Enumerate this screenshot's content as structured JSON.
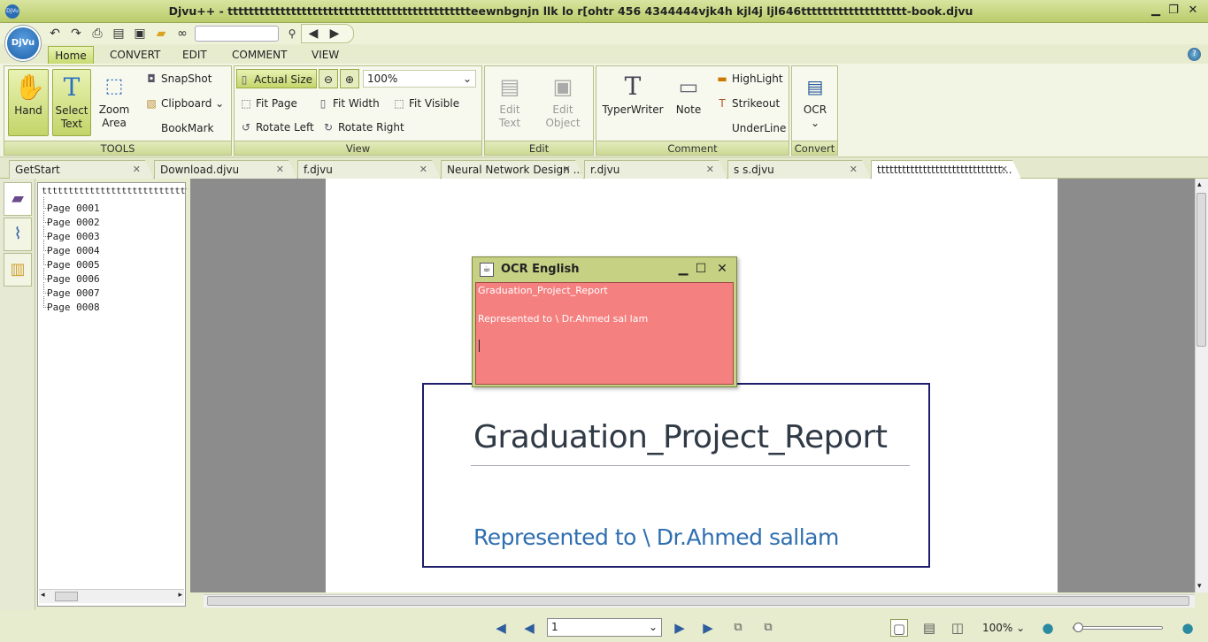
{
  "window": {
    "title": "Djvu++ - tttttttttttttttttttttttttttttttttttttttttttttteewnbgnjn llk lo   r[ohtr 456 4344444vjk4h kjl4j ljl646tttttttttttttttttttt-book.djvu",
    "minimize": "▁",
    "restore": "❐",
    "close": "✕"
  },
  "logo_text": "DjVu",
  "menu": {
    "tabs": [
      {
        "label": "Home",
        "active": true
      },
      {
        "label": "CONVERT"
      },
      {
        "label": "EDIT"
      },
      {
        "label": "COMMENT"
      },
      {
        "label": "VIEW"
      }
    ],
    "help": "?"
  },
  "ribbon": {
    "tools": {
      "label": "TOOLS",
      "hand": "Hand",
      "select_text": "Select Text",
      "zoom_area": "Zoom Area",
      "snapshot": "SnapShot",
      "clipboard": "Clipboard",
      "bookmark": "BookMark"
    },
    "view": {
      "label": "View",
      "actual_size": "Actual Size",
      "zoom_value": "100%",
      "fit_page": "Fit Page",
      "fit_width": "Fit Width",
      "fit_visible": "Fit Visible",
      "rotate_left": "Rotate Left",
      "rotate_right": "Rotate Right"
    },
    "edit": {
      "label": "Edit",
      "edit_text": "Edit Text",
      "edit_object": "Edit Object"
    },
    "comment": {
      "label": "Comment",
      "typewriter": "TyperWriter",
      "note": "Note",
      "highlight": "HighLight",
      "strikeout": "Strikeout",
      "underline": "UnderLine"
    },
    "convert": {
      "label": "Convert",
      "ocr": "OCR"
    }
  },
  "doc_tabs": [
    {
      "label": "GetStart"
    },
    {
      "label": "Download.djvu"
    },
    {
      "label": "f.djvu"
    },
    {
      "label": "Neural Network Design ..."
    },
    {
      "label": "r.djvu"
    },
    {
      "label": "s s.djvu"
    },
    {
      "label": "tttttttttttttttttttttttttttttt...",
      "active": true
    }
  ],
  "tree": {
    "root": "tttttttttttttttttttttttttttttttttttttttttttttteewnbgnjn",
    "pages": [
      "Page 0001",
      "Page 0002",
      "Page 0003",
      "Page 0004",
      "Page 0005",
      "Page 0006",
      "Page 0007",
      "Page 0008"
    ]
  },
  "document": {
    "title": "Graduation_Project_Report",
    "subtitle": "Represented to \\ Dr.Ahmed sallam"
  },
  "ocr_window": {
    "title": "OCR English",
    "lines": [
      "Graduation_Project_Report",
      "",
      "Represented to \\ Dr.Ahmed sal lam"
    ]
  },
  "status": {
    "page_value": "1",
    "zoom": "100%"
  }
}
